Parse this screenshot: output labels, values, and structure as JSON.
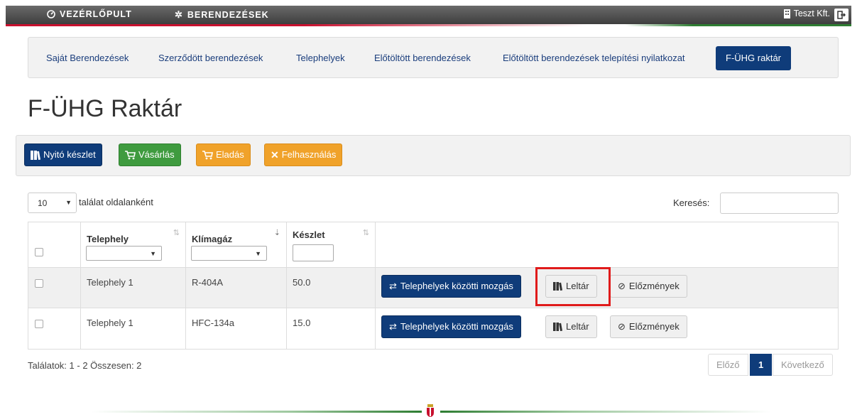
{
  "topbar": {
    "nav": [
      {
        "label": "VEZÉRLŐPULT"
      },
      {
        "label": "BERENDEZÉSEK"
      }
    ],
    "company": "Teszt Kft."
  },
  "subnav": {
    "tabs": [
      {
        "label": "Saját Berendezések",
        "active": false
      },
      {
        "label": "Szerződött berendezések",
        "active": false
      },
      {
        "label": "Telephelyek",
        "active": false
      },
      {
        "label": "Előtöltött berendezések",
        "active": false
      },
      {
        "label": "Előtöltött berendezések telepítési nyilatkozat",
        "active": false
      },
      {
        "label": "F-ÜHG raktár",
        "active": true
      }
    ]
  },
  "page": {
    "title": "F-ÜHG Raktár"
  },
  "actions": {
    "opening_stock": "Nyitó készlet",
    "purchase": "Vásárlás",
    "sale": "Eladás",
    "usage": "Felhasználás"
  },
  "table_controls": {
    "page_length": "10",
    "page_length_label": "találat oldalanként",
    "search_label": "Keresés:"
  },
  "table": {
    "columns": [
      "Telephely",
      "Klímagáz",
      "Készlet"
    ],
    "rows": [
      {
        "site": "Telephely 1",
        "gas": "R-404A",
        "stock": "50.0"
      },
      {
        "site": "Telephely 1",
        "gas": "HFC-134a",
        "stock": "15.0"
      }
    ],
    "row_buttons": {
      "move": "Telephelyek közötti mozgás",
      "inventory": "Leltár",
      "history": "Előzmények"
    }
  },
  "pagination": {
    "info": "Találatok: 1 - 2 Összesen: 2",
    "prev": "Előző",
    "current": "1",
    "next": "Következő"
  },
  "colors": {
    "navy": "#0f3c7a",
    "green": "#3f9b3f",
    "orange": "#f0a22a",
    "highlight_red": "#e01b1b"
  }
}
